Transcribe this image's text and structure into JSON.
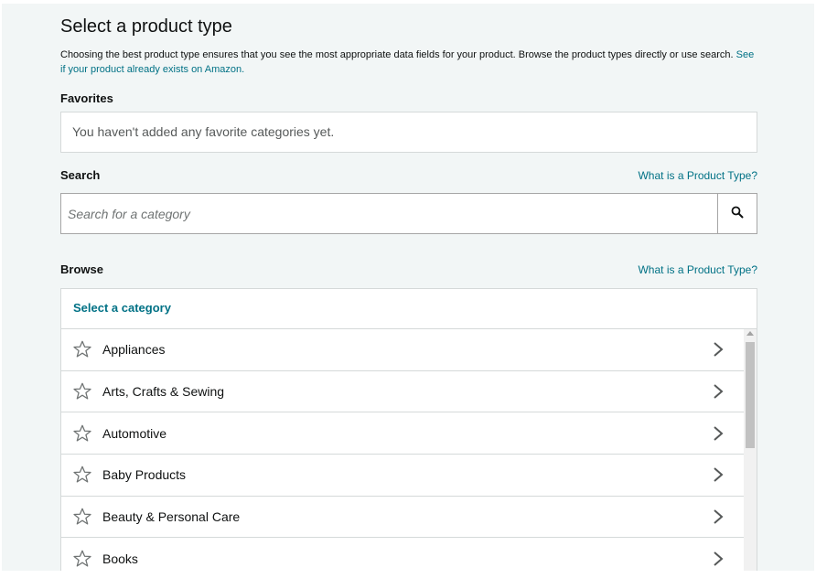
{
  "page": {
    "title": "Select a product type",
    "description": "Choosing the best product type ensures that you see the most appropriate data fields for your product. Browse the product types directly or use search.",
    "description_link": "See if your product already exists on Amazon."
  },
  "favorites": {
    "label": "Favorites",
    "empty_text": "You haven't added any favorite categories yet."
  },
  "search": {
    "label": "Search",
    "help_link": "What is a Product Type?",
    "placeholder": "Search for a category",
    "button_icon": "search-icon"
  },
  "browse": {
    "label": "Browse",
    "help_link": "What is a Product Type?",
    "header": "Select a category",
    "items": [
      {
        "label": "Appliances"
      },
      {
        "label": "Arts, Crafts & Sewing"
      },
      {
        "label": "Automotive"
      },
      {
        "label": "Baby Products"
      },
      {
        "label": "Beauty & Personal Care"
      },
      {
        "label": "Books"
      }
    ]
  },
  "colors": {
    "link": "#007185",
    "background": "#f2f6f6",
    "border": "#d5d9d9"
  }
}
